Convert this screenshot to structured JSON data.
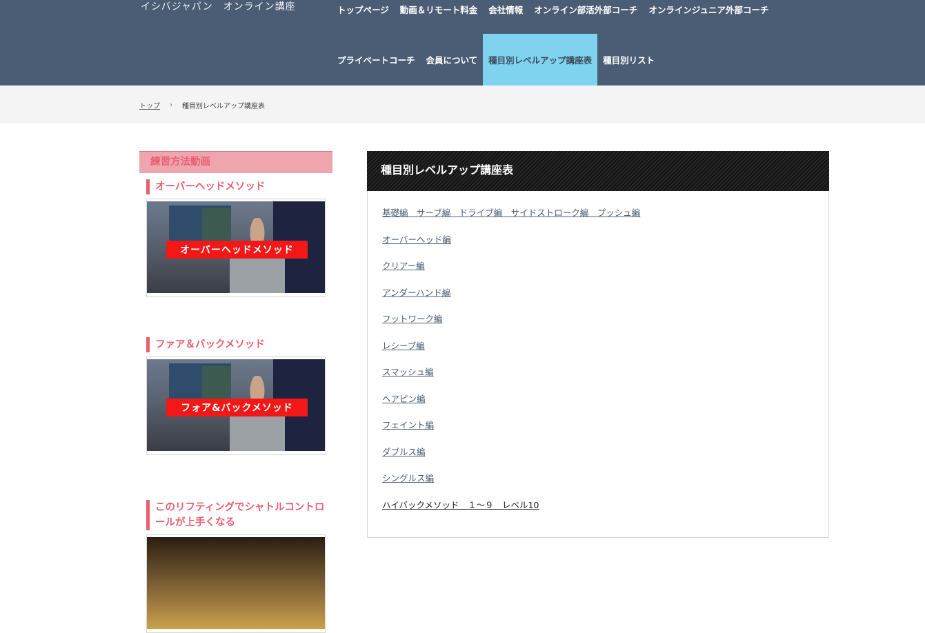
{
  "header": {
    "site_title": "イシバジャパン　オンライン講座",
    "nav_row1": [
      "トップページ",
      "動画＆リモート料金",
      "会社情報",
      "オンライン部活外部コーチ",
      "オンラインジュニア外部コーチ"
    ],
    "nav_row2": [
      "プライベートコーチ",
      "会員について",
      "種目別レベルアップ講座表",
      "種目別リスト"
    ]
  },
  "breadcrumb": {
    "home": "トップ",
    "separator": "›",
    "current": "種目別レベルアップ講座表"
  },
  "sidebar": {
    "heading": "練習方法動画",
    "videos": [
      {
        "title": "オーバーヘッドメソッド",
        "banner": "オーバーヘッドメソッド"
      },
      {
        "title": "ファア＆バックメソッド",
        "banner": "フォア&バックメソッド"
      },
      {
        "title": "このリフティングでシャトルコントロールが上手くなる",
        "banner": ""
      }
    ]
  },
  "main": {
    "heading": "種目別レベルアップ講座表",
    "links": [
      "基礎編　サーブ編　ドライブ編　サイドストローク編　プッシュ編",
      "オーバーヘッド編",
      "クリアー編",
      "アンダーハンド編",
      "フットワーク編",
      "レシーブ編",
      "スマッシュ編",
      "ヘアピン編",
      "フェイント編",
      "ダブルス編",
      "シングルス編",
      "ハイバックメソッド　１～９　レベル10"
    ]
  },
  "colors": {
    "header_bg": "#4b5d74",
    "nav_active_bg": "#7fd3ef",
    "accent_pink": "#e8606f",
    "sidebar_head_bg": "#efa5ae"
  }
}
